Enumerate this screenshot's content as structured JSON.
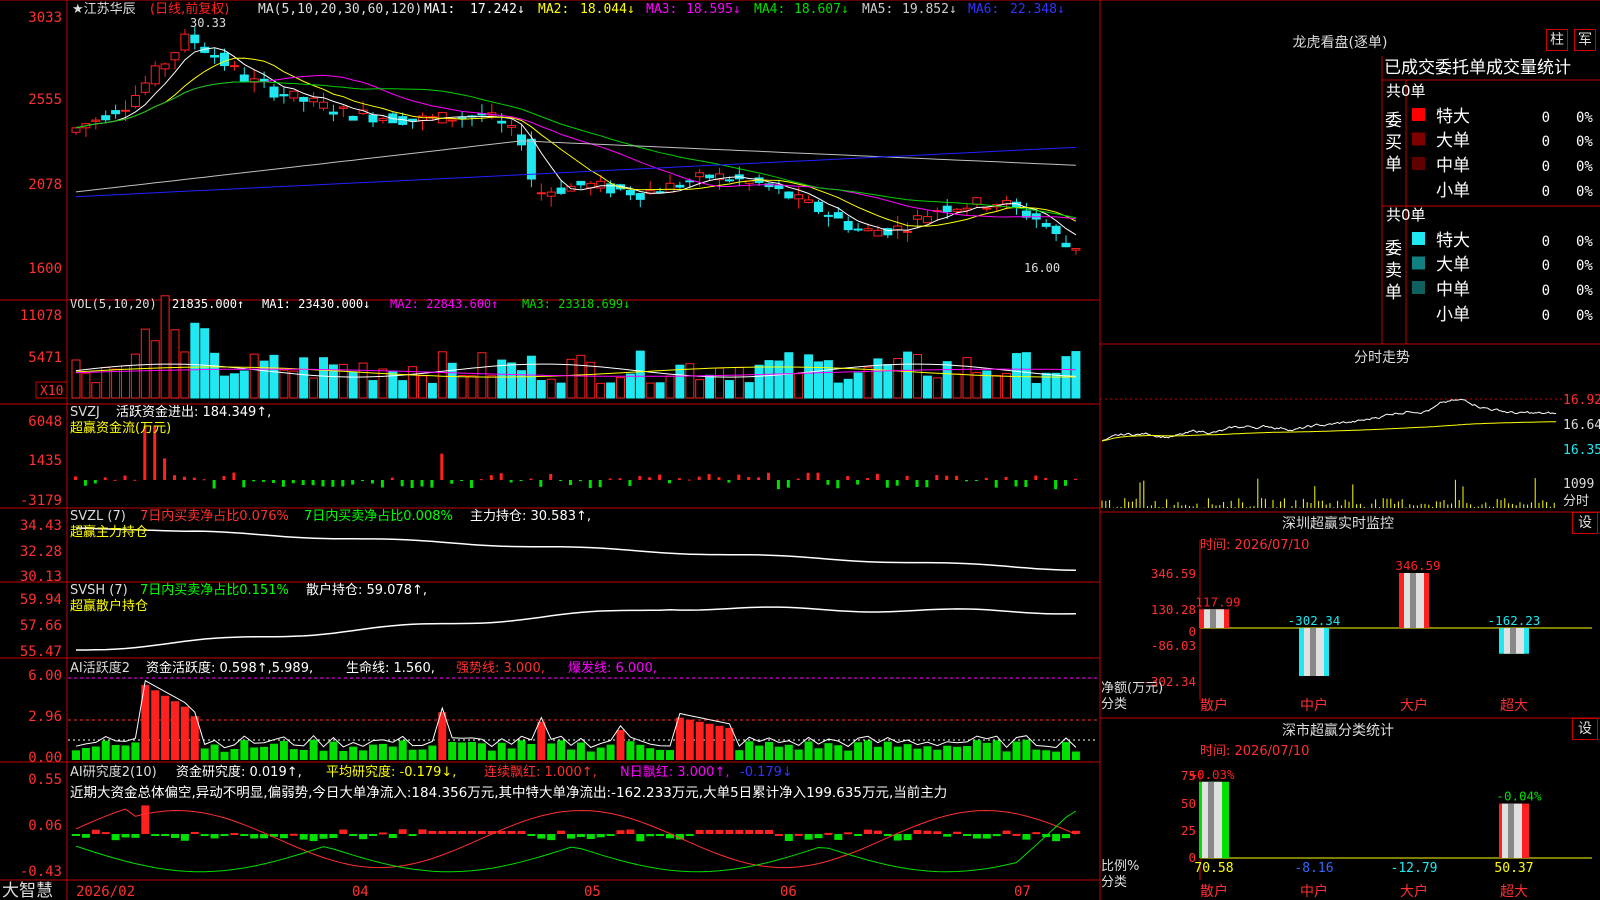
{
  "colors": {
    "up": "#ff2020",
    "down": "#20e8f0",
    "frame": "#c00000",
    "ma1": "#ffffff",
    "ma2": "#ffff00",
    "ma3": "#ff00ff",
    "ma4": "#00d000",
    "ma5": "#c0c0c0",
    "ma6": "#2020ff",
    "green": "#00e000",
    "yellow": "#ffff00"
  },
  "main": {
    "stock_name": "江苏华辰",
    "period_tag": "(日线,前复权)",
    "ma_legend": "MA(5,10,20,30,60,120)",
    "ma": [
      {
        "label": "MA1:",
        "value": "17.242↓"
      },
      {
        "label": "MA2:",
        "value": "18.044↓"
      },
      {
        "label": "MA3:",
        "value": "18.595↓"
      },
      {
        "label": "MA4:",
        "value": "18.607↓"
      },
      {
        "label": "MA5:",
        "value": "19.852↓"
      },
      {
        "label": "MA6:",
        "value": "22.348↓"
      }
    ],
    "y_ticks": [
      "3033",
      "2555",
      "2078",
      "1600"
    ],
    "high_label": "30.33",
    "low_label": "16.00"
  },
  "vol": {
    "legend": "VOL(5,10,20)",
    "value": "21835.000↑",
    "ma1": "MA1: 23430.000↓",
    "ma2": "MA2: 22843.600↑",
    "ma3": "MA3: 23318.699↓",
    "y_ticks": [
      "11078",
      "5471"
    ],
    "unit": "X10"
  },
  "svzj": {
    "legend": "SVZJ",
    "title": "活跃资金进出: 184.349↑,",
    "subtitle": "超赢资金流(万元)",
    "y_ticks": [
      "6048",
      "1435",
      "-3179"
    ]
  },
  "svzl": {
    "legend": "SVZL (7)",
    "t1": "7日内买卖净占比0.076%",
    "t2": "7日内买卖净占比0.008%",
    "t3": "主力持仓: 30.583↑,",
    "subtitle": "超赢主力持仓",
    "y_ticks": [
      "34.43",
      "32.28",
      "30.13"
    ]
  },
  "svsh": {
    "legend": "SVSH (7)",
    "t1": "7日内买卖净占比0.151%",
    "t2": "散户持仓: 59.078↑,",
    "subtitle": "超赢散户持仓",
    "y_ticks": [
      "59.94",
      "57.66",
      "55.47"
    ]
  },
  "ai1": {
    "legend": "AI活跃度2",
    "t1": "资金活跃度: 0.598↑,5.989,",
    "t2": "生命线: 1.560,",
    "t3": "强势线: 3.000,",
    "t4": "爆发线: 6.000,",
    "y_ticks": [
      "6.00",
      "2.96",
      "0.00"
    ]
  },
  "ai2": {
    "legend": "AI研究度2(10)",
    "t1": "资金研究度: 0.019↑,",
    "t2": "平均研究度: -0.179↓,",
    "t3": "连续飘红: 1.000↑,",
    "t4": "N日飘红: 3.000↑,",
    "t5": "-0.179↓",
    "comment": "近期大资金总体偏空,异动不明显,偏弱势,今日大单净流入:184.356万元,其中特大单净流出:-162.233万元,大单5日累计净入199.635万元,当前主力",
    "y_ticks": [
      "0.55",
      "0.06",
      "-0.43"
    ]
  },
  "xaxis": {
    "brand": "大智慧",
    "labels": [
      "2026/02",
      "04",
      "05",
      "06",
      "07"
    ]
  },
  "dragon": {
    "title": "龙虎看盘(逐单)",
    "btn1": "柱",
    "btn2": "军",
    "header": "已成交委托单成交量统计",
    "buy": {
      "label": "委买单",
      "total": "共0单",
      "rows": [
        {
          "name": "特大",
          "v": "0",
          "p": "0%"
        },
        {
          "name": "大单",
          "v": "0",
          "p": "0%"
        },
        {
          "name": "中单",
          "v": "0",
          "p": "0%"
        },
        {
          "name": "小单",
          "v": "0",
          "p": "0%"
        }
      ]
    },
    "sell": {
      "label": "委卖单",
      "total": "共0单",
      "rows": [
        {
          "name": "特大",
          "v": "0",
          "p": "0%"
        },
        {
          "name": "大单",
          "v": "0",
          "p": "0%"
        },
        {
          "name": "中单",
          "v": "0",
          "p": "0%"
        },
        {
          "name": "小单",
          "v": "0",
          "p": "0%"
        }
      ]
    }
  },
  "intraday": {
    "title": "分时走势",
    "y_ticks": [
      "16.92",
      "16.64",
      "16.35"
    ],
    "vol_tick": "1099",
    "vol_label": "分时"
  },
  "monitor": {
    "title": "深圳超赢实时监控",
    "btn": "设",
    "time": "时间: 2026/07/10",
    "y_ticks": [
      "346.59",
      "130.28",
      "0",
      "-86.03",
      "-302.34"
    ],
    "ylabel": "净额(万元)",
    "xlabel": "分类",
    "categories": [
      "散户",
      "中户",
      "大户",
      "超大"
    ],
    "values": [
      117.99,
      -302.34,
      346.59,
      -162.23
    ],
    "value_labels": [
      "117.99",
      "-302.34",
      "346.59",
      "-162.23"
    ]
  },
  "classify": {
    "title": "深市超赢分类统计",
    "btn": "设",
    "time": "时间: 2026/07/10",
    "y_ticks": [
      "75",
      "50",
      "25",
      "0"
    ],
    "ylabel": "比例%",
    "xlabel": "分类",
    "categories": [
      "散户",
      "中户",
      "大户",
      "超大"
    ],
    "values": [
      70.58,
      -8.16,
      -12.79,
      50.37
    ],
    "value_labels": [
      "70.58",
      "-8.16",
      "-12.79",
      "50.37"
    ],
    "change_labels": [
      "+0.03%",
      "",
      "",
      "-0.04%"
    ]
  },
  "chart_data": [
    {
      "type": "bar",
      "title": "深圳超赢实时监控",
      "categories": [
        "散户",
        "中户",
        "大户",
        "超大"
      ],
      "values": [
        117.99,
        -302.34,
        346.59,
        -162.23
      ],
      "ylabel": "净额(万元)",
      "xlabel": "分类",
      "ylim": [
        -302.34,
        346.59
      ]
    },
    {
      "type": "bar",
      "title": "深市超赢分类统计",
      "categories": [
        "散户",
        "中户",
        "大户",
        "超大"
      ],
      "values": [
        70.58,
        -8.16,
        -12.79,
        50.37
      ],
      "ylabel": "比例%",
      "xlabel": "分类",
      "ylim": [
        0,
        75
      ]
    }
  ]
}
